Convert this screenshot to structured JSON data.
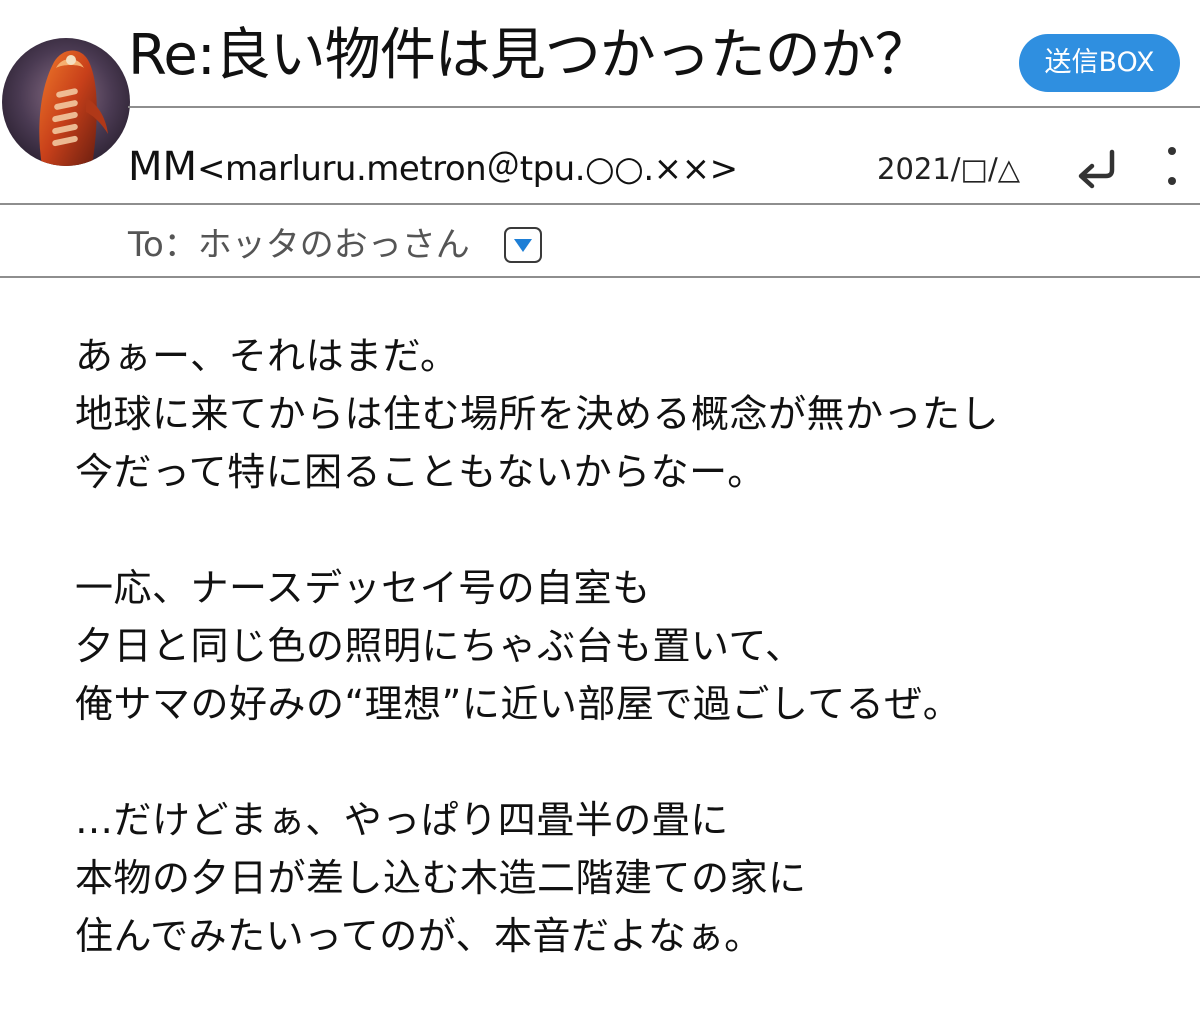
{
  "header": {
    "subject": "Re:良い物件は見つかったのか？",
    "sent_box_button": "送信BOX"
  },
  "sender": {
    "name": "MM",
    "email": "<marluru.metron＠tpu.○○.××>",
    "date": "2021/□/△"
  },
  "recipient": {
    "label": "To：ホッタのおっさん"
  },
  "body": {
    "paragraphs": [
      [
        "あぁー、それはまだ。",
        "地球に来てからは住む場所を決める概念が無かったし",
        "今だって特に困ることもないからなー。"
      ],
      [
        "一応、ナースデッセイ号の自室も",
        "夕日と同じ色の照明にちゃぶ台も置いて、",
        "俺サマの好みの“理想”に近い部屋で過ごしてるぜ。"
      ],
      [
        "…だけどまぁ、やっぱり四畳半の畳に",
        "本物の夕日が差し込む木造二階建ての家に",
        "住んでみたいってのが、本音だよなぁ。"
      ]
    ]
  },
  "icons": {
    "avatar": "avatar",
    "reply": "reply-icon",
    "more": "more-vertical-icon",
    "dropdown": "dropdown-triangle-icon"
  },
  "colors": {
    "accent": "#2f8fe0",
    "divider": "#8e8e8e",
    "dropdown_arrow": "#1e7fd6"
  }
}
